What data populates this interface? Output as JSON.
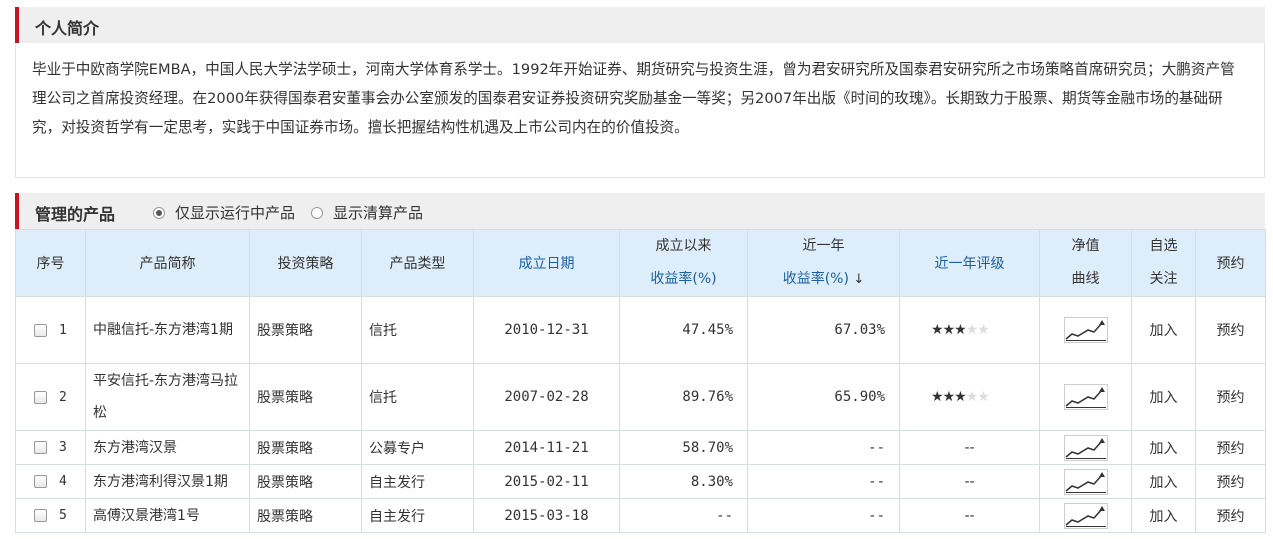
{
  "intro": {
    "title": "个人简介",
    "text": "毕业于中欧商学院EMBA，中国人民大学法学硕士，河南大学体育系学士。1992年开始证券、期货研究与投资生涯，曾为君安研究所及国泰君安研究所之市场策略首席研究员；大鹏资产管理公司之首席投资经理。在2000年获得国泰君安董事会办公室颁发的国泰君安证券投资研究奖励基金一等奖；另2007年出版《时间的玫瑰》。长期致力于股票、期货等金融市场的基础研究，对投资哲学有一定思考，实践于中国证券市场。擅长把握结构性机遇及上市公司内在的价值投资。"
  },
  "products": {
    "title": "管理的产品",
    "filter_running": "仅显示运行中产品",
    "filter_running_selected": true,
    "filter_liquidated": "显示清算产品",
    "headers": {
      "index": "序号",
      "name": "产品简称",
      "strategy": "投资策略",
      "type": "产品类型",
      "inception_date": "成立日期",
      "since_inception_l1": "成立以来",
      "since_inception_l2": "收益率(%)",
      "one_year_l1": "近一年",
      "one_year_l2": "收益率(%)",
      "one_year_sort": "↓",
      "one_year_rating": "近一年评级",
      "nav_l1": "净值",
      "nav_l2": "曲线",
      "watch_l1": "自选",
      "watch_l2": "关注",
      "reserve": "预约"
    },
    "rows": [
      {
        "index": "1",
        "name": "中融信托-东方港湾1期",
        "strategy": "股票策略",
        "type": "信托",
        "date": "2010-12-31",
        "since": "47.45%",
        "year": "67.03%",
        "rating": 3,
        "rating_text": "",
        "watch": "加入",
        "reserve": "预约",
        "tall": true
      },
      {
        "index": "2",
        "name": "平安信托-东方港湾马拉松",
        "strategy": "股票策略",
        "type": "信托",
        "date": "2007-02-28",
        "since": "89.76%",
        "year": "65.90%",
        "rating": 3,
        "rating_text": "",
        "watch": "加入",
        "reserve": "预约",
        "tall": true
      },
      {
        "index": "3",
        "name": "东方港湾汉景",
        "strategy": "股票策略",
        "type": "公募专户",
        "date": "2014-11-21",
        "since": "58.70%",
        "year": "--",
        "rating": 0,
        "rating_text": "--",
        "watch": "加入",
        "reserve": "预约",
        "tall": false
      },
      {
        "index": "4",
        "name": "东方港湾利得汉景1期",
        "strategy": "股票策略",
        "type": "自主发行",
        "date": "2015-02-11",
        "since": "8.30%",
        "year": "--",
        "rating": 0,
        "rating_text": "--",
        "watch": "加入",
        "reserve": "预约",
        "tall": false
      },
      {
        "index": "5",
        "name": "高傅汉景港湾1号",
        "strategy": "股票策略",
        "type": "自主发行",
        "date": "2015-03-18",
        "since": "--",
        "year": "--",
        "rating": 0,
        "rating_text": "--",
        "watch": "加入",
        "reserve": "预约",
        "tall": false
      }
    ]
  },
  "icons": {
    "nav_curve": "line-chart-icon",
    "checkbox": "checkbox-icon",
    "star": "star-icon"
  },
  "colors": {
    "accent": "#c8141e",
    "header_bg": "#ddeefa",
    "link_blue": "#1d4f8a"
  }
}
